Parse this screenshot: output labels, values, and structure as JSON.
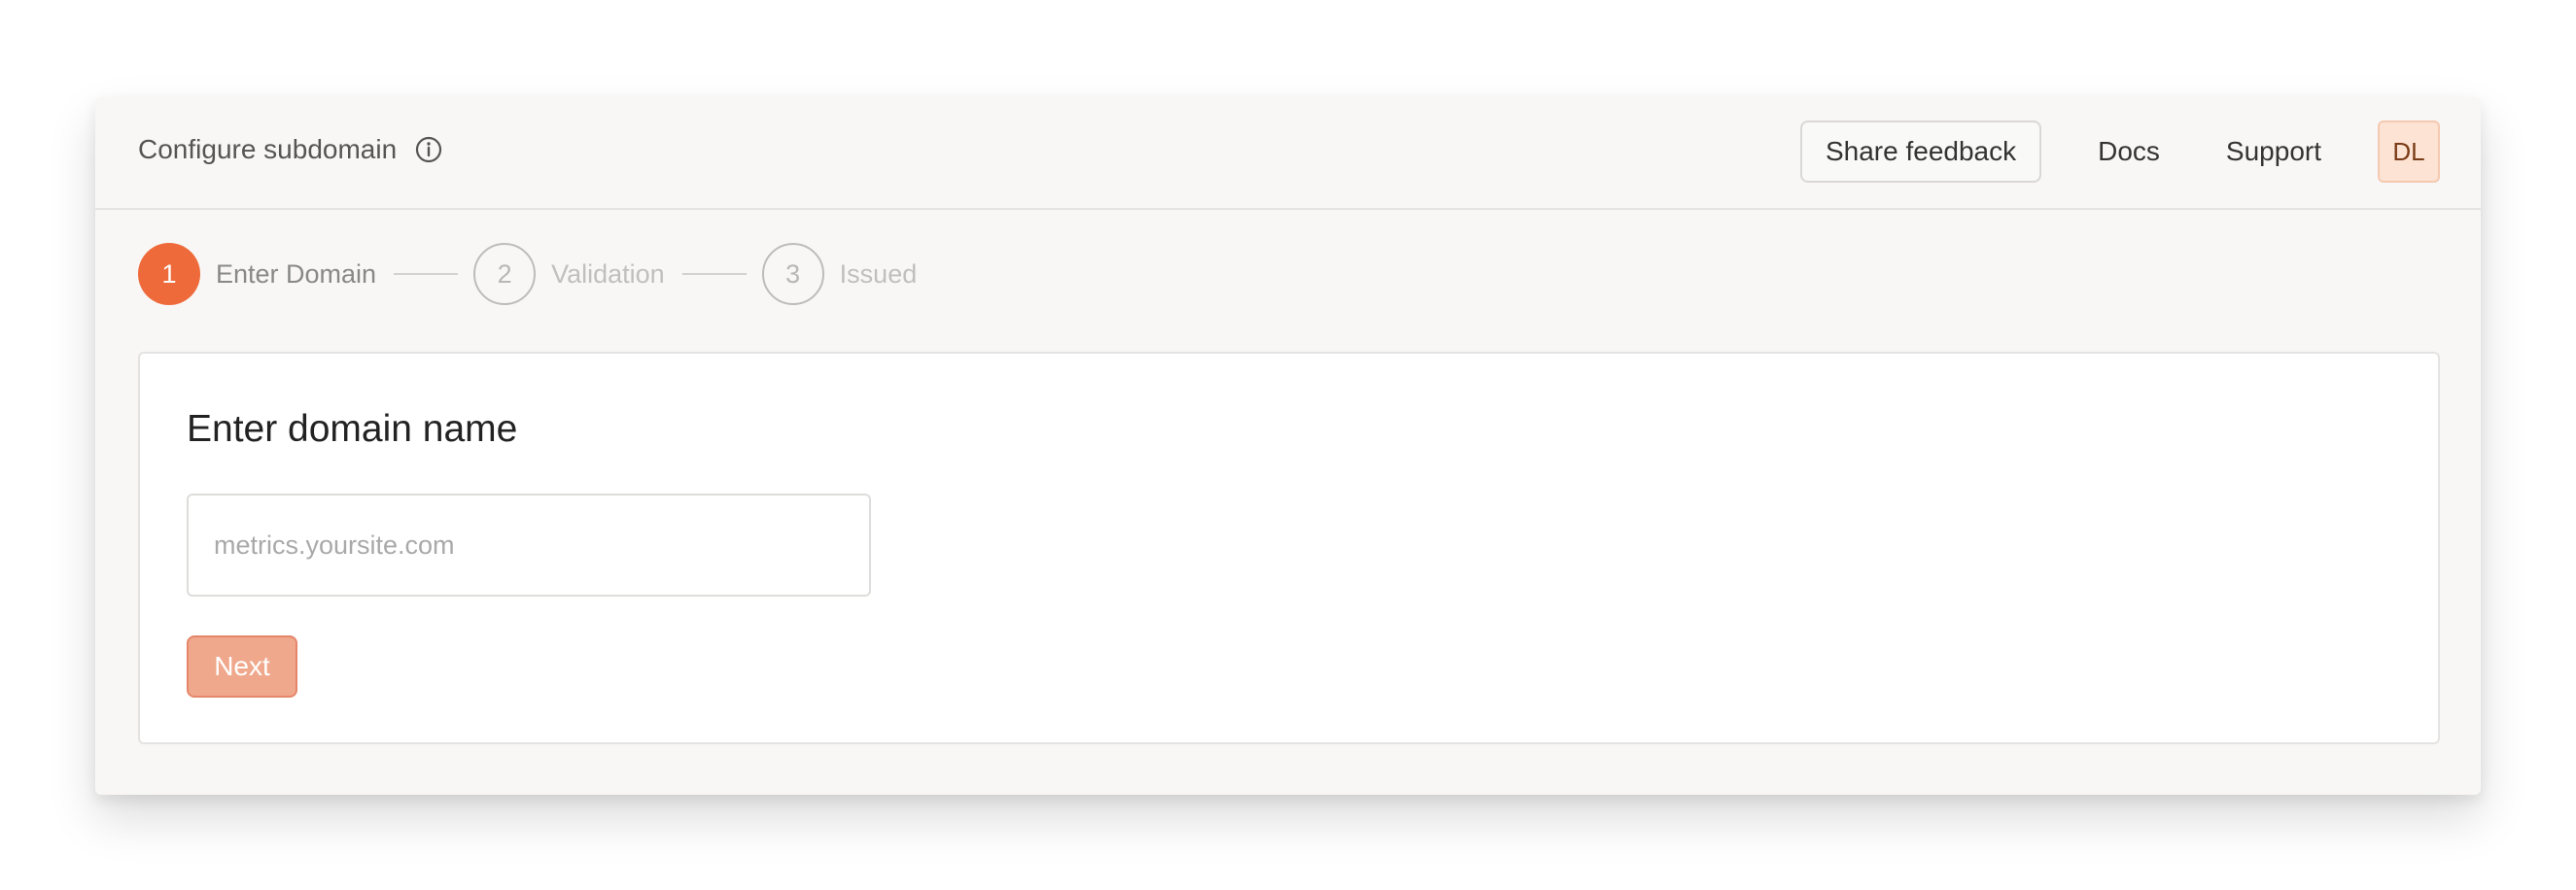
{
  "header": {
    "title": "Configure subdomain",
    "info_icon": "info-icon",
    "share_feedback_label": "Share feedback",
    "docs_label": "Docs",
    "support_label": "Support",
    "avatar_initials": "DL"
  },
  "stepper": {
    "steps": [
      {
        "number": "1",
        "label": "Enter Domain",
        "state": "active"
      },
      {
        "number": "2",
        "label": "Validation",
        "state": "inactive"
      },
      {
        "number": "3",
        "label": "Issued",
        "state": "inactive"
      }
    ]
  },
  "form": {
    "title": "Enter domain name",
    "domain_placeholder": "metrics.yoursite.com",
    "domain_value": "",
    "next_label": "Next"
  },
  "colors": {
    "accent": "#ee6a3a",
    "next_button_bg": "#f0a88c",
    "avatar_bg": "#fde3d3"
  }
}
